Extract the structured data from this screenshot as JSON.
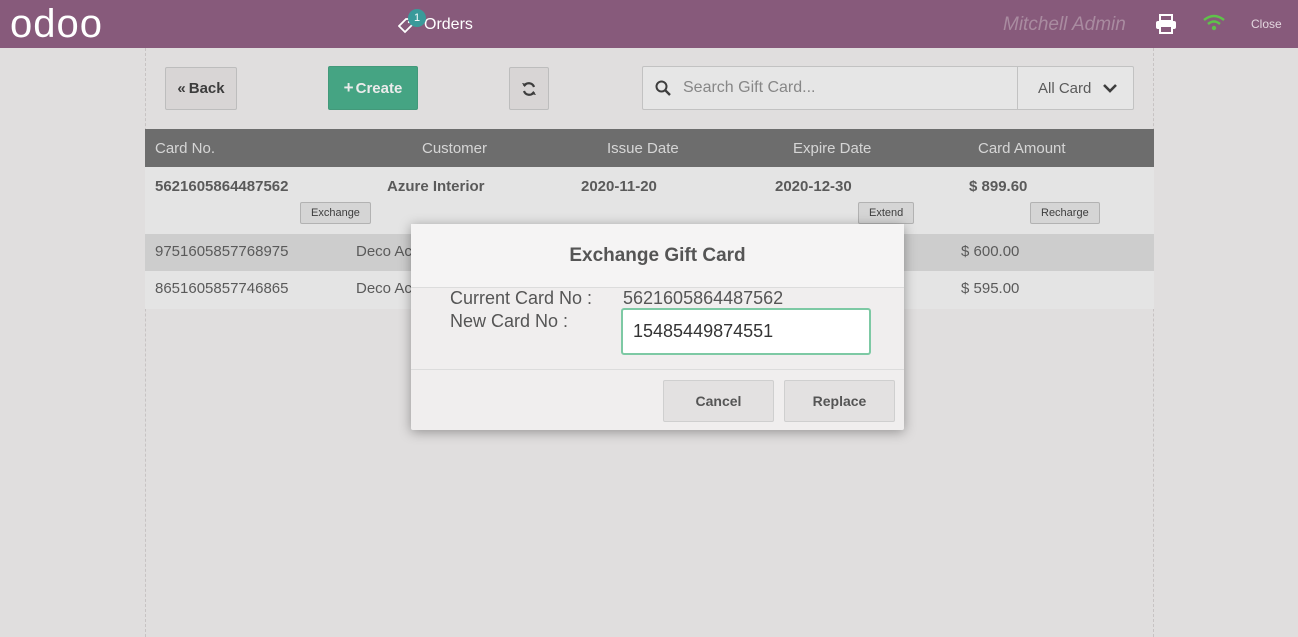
{
  "topbar": {
    "logo": "odoo",
    "orders_label": "Orders",
    "orders_badge": "1",
    "user": "Mitchell Admin",
    "close_label": "Close"
  },
  "toolbar": {
    "back_label": "Back",
    "create_label": "Create",
    "search_placeholder": "Search Gift Card...",
    "filter_value": "All Card"
  },
  "table": {
    "headers": [
      "Card No.",
      "Customer",
      "Issue Date",
      "Expire Date",
      "Card Amount"
    ],
    "rows": [
      {
        "card_no": "5621605864487562",
        "customer": "Azure Interior",
        "issue": "2020-11-20",
        "expire": "2020-12-30",
        "amount": "$ 899.60",
        "actions": {
          "exchange": "Exchange",
          "extend": "Extend",
          "recharge": "Recharge"
        }
      },
      {
        "card_no": "9751605857768975",
        "customer": "Deco Ac",
        "amount": "$ 600.00"
      },
      {
        "card_no": "8651605857746865",
        "customer": "Deco Ac",
        "amount": "$ 595.00"
      }
    ]
  },
  "modal": {
    "title": "Exchange Gift Card",
    "current_label": "Current Card No :",
    "current_value": "5621605864487562",
    "new_label": "New Card No :",
    "new_value": "15485449874551",
    "cancel_label": "Cancel",
    "replace_label": "Replace"
  },
  "colors": {
    "topbar": "#875a7b",
    "create_button": "#3dac85",
    "table_header": "#6b6b6b",
    "input_focus": "#7dc9a4"
  }
}
